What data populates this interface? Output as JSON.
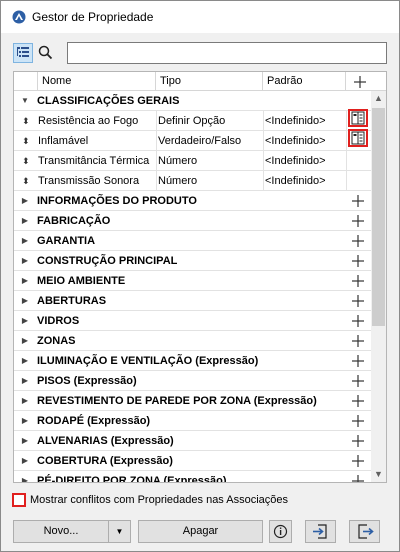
{
  "window": {
    "title": "Gestor de Propriedade"
  },
  "search": {
    "value": "",
    "placeholder": ""
  },
  "columns": {
    "name": "Nome",
    "type": "Tipo",
    "default": "Padrão"
  },
  "expanded_group": {
    "label": "CLASSIFICAÇÕES GERAIS",
    "properties": [
      {
        "name": "Resistência ao Fogo",
        "type": "Definir Opção",
        "default": "<Indefinido>",
        "has_association_icon": true
      },
      {
        "name": "Inflamável",
        "type": "Verdadeiro/Falso",
        "default": "<Indefinido>",
        "has_association_icon": true
      },
      {
        "name": "Transmitância Térmica",
        "type": "Número",
        "default": "<Indefinido>",
        "has_association_icon": false
      },
      {
        "name": "Transmissão Sonora",
        "type": "Número",
        "default": "<Indefinido>",
        "has_association_icon": false
      }
    ]
  },
  "groups": [
    "INFORMAÇÕES DO PRODUTO",
    "FABRICAÇÃO",
    "GARANTIA",
    "CONSTRUÇÃO PRINCIPAL",
    "MEIO AMBIENTE",
    "ABERTURAS",
    "VIDROS",
    "ZONAS",
    "ILUMINAÇÃO E VENTILAÇÃO (Expressão)",
    "PISOS (Expressão)",
    "REVESTIMENTO DE PAREDE POR ZONA (Expressão)",
    "RODAPÉ (Expressão)",
    "ALVENARIAS (Expressão)",
    "COBERTURA (Expressão)",
    "PÉ-DIREITO POR ZONA (Expressão)"
  ],
  "footer": {
    "checkbox_label": "Mostrar conflitos com Propriedades nas Associações",
    "checkbox_checked": false,
    "new_label": "Novo...",
    "delete_label": "Apagar"
  },
  "icons": {
    "app": "app-logo-icon",
    "tree_view": "tree-view-icon",
    "search": "search-icon",
    "add": "plus-icon",
    "association": "association-icon",
    "info": "info-icon",
    "import": "import-icon",
    "export": "export-icon"
  },
  "colors": {
    "highlight_border": "#e0201e",
    "selected_toggle": "#cce4f7"
  }
}
